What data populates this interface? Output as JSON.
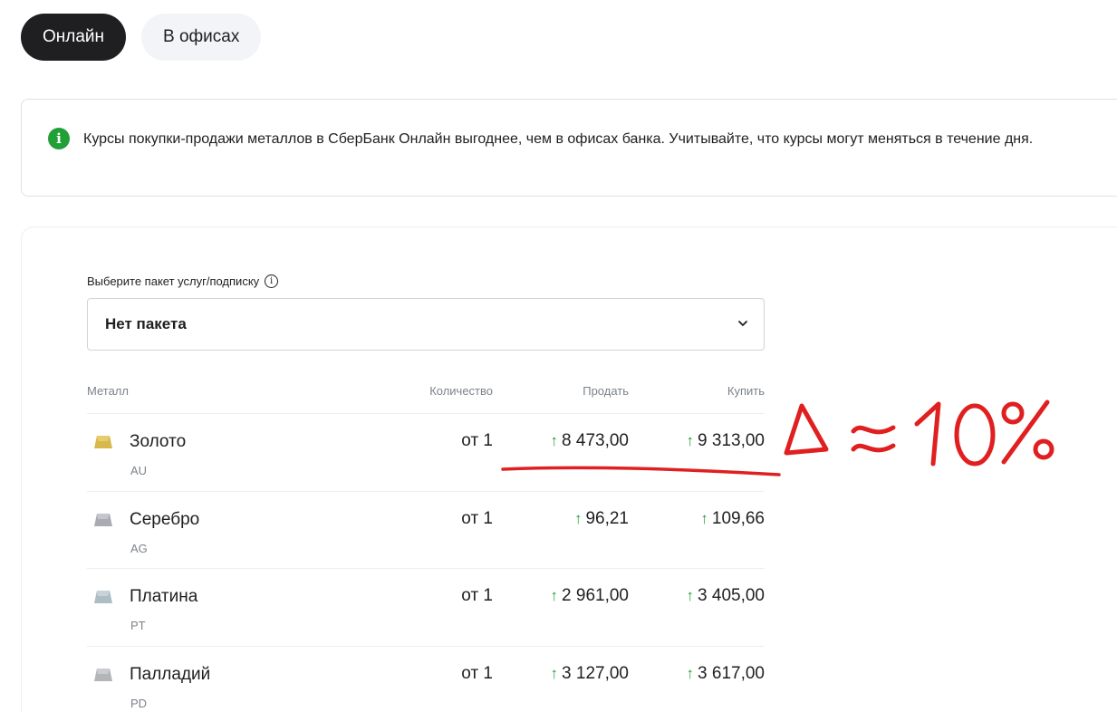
{
  "tabs": [
    {
      "label": "Онлайн",
      "active": true
    },
    {
      "label": "В офисах",
      "active": false
    }
  ],
  "info": {
    "icon": "info-icon",
    "text": "Курсы покупки-продажи металлов в СберБанк Онлайн выгоднее, чем в офисах банка. Учитывайте, что курсы могут меняться в течение дня."
  },
  "package": {
    "label": "Выберите пакет услуг/подписку",
    "help_icon": "i",
    "value": "Нет пакета"
  },
  "table": {
    "headers": {
      "metal": "Металл",
      "qty": "Количество",
      "sell": "Продать",
      "buy": "Купить"
    },
    "rows": [
      {
        "name": "Золото",
        "code": "AU",
        "qty": "от 1",
        "sell": "8 473,00",
        "buy": "9 313,00",
        "color": "#d7b84c"
      },
      {
        "name": "Серебро",
        "code": "AG",
        "qty": "от 1",
        "sell": "96,21",
        "buy": "109,66",
        "color": "#a8acb2"
      },
      {
        "name": "Платина",
        "code": "PT",
        "qty": "от 1",
        "sell": "2 961,00",
        "buy": "3 405,00",
        "color": "#aebcc4"
      },
      {
        "name": "Палладий",
        "code": "PD",
        "qty": "от 1",
        "sell": "3 127,00",
        "buy": "3 617,00",
        "color": "#b3b5b9"
      }
    ],
    "arrow": "↑"
  },
  "annotation": {
    "text": "Δ ≈ 10%",
    "color": "#e02020"
  },
  "colors": {
    "accent": "#21a038",
    "dark": "#1f1f22",
    "muted": "#7d838a"
  }
}
